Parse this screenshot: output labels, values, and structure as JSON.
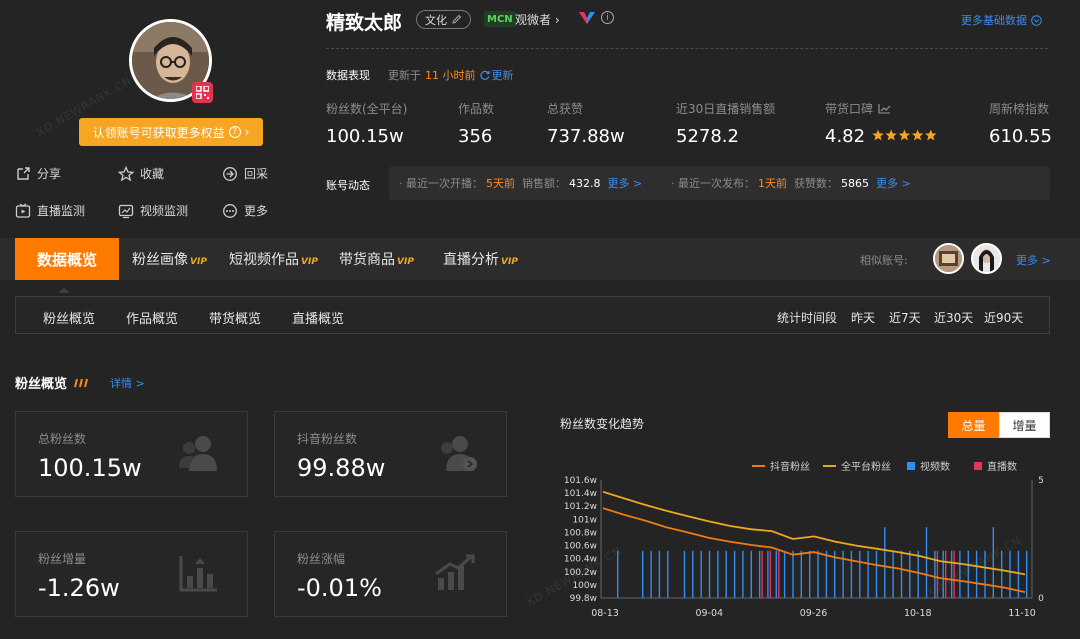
{
  "profile": {
    "claim_text": "认领账号可获取更多权益",
    "actions": [
      {
        "icon": "share-icon",
        "label": "分享"
      },
      {
        "icon": "star-icon",
        "label": "收藏"
      },
      {
        "icon": "back-icon",
        "label": "回采"
      },
      {
        "icon": "live-monitor-icon",
        "label": "直播监测"
      },
      {
        "icon": "video-monitor-icon",
        "label": "视频监测"
      },
      {
        "icon": "more-icon",
        "label": "更多"
      }
    ]
  },
  "header": {
    "name": "精致太郎",
    "tag": "文化",
    "mcn_badge": "MCN",
    "mcn_name": "观微者",
    "more_basic": "更多基础数据",
    "perf_label": "数据表现",
    "updated_prefix": "更新于",
    "updated_time": "11 小时前",
    "refresh": "更新"
  },
  "stats": [
    {
      "label": "粉丝数(全平台)",
      "value": "100.15w"
    },
    {
      "label": "作品数",
      "value": "356"
    },
    {
      "label": "总获赞",
      "value": "737.88w"
    },
    {
      "label": "近30日直播销售额",
      "value": "5278.2"
    },
    {
      "label": "带货口碑",
      "value": "4.82"
    },
    {
      "label": "周新榜指数",
      "value": "610.55"
    }
  ],
  "rating_stars": 4.82,
  "dynamics": {
    "label": "账号动态",
    "live_prefix": "· 最近一次开播：",
    "live_time": "5天前",
    "sales_label": "销售额：",
    "sales_value": "432.8",
    "more1": "更多 >",
    "post_prefix": "· 最近一次发布：",
    "post_time": "1天前",
    "likes_label": "获赞数：",
    "likes_value": "5865",
    "more2": "更多 >"
  },
  "tabs": {
    "active": "数据概览",
    "items": [
      {
        "label": "粉丝画像",
        "vip": "VIP"
      },
      {
        "label": "短视频作品",
        "vip": "VIP"
      },
      {
        "label": "带货商品",
        "vip": "VIP"
      },
      {
        "label": "直播分析",
        "vip": "VIP"
      }
    ],
    "similar_label": "相似账号:",
    "similar_more": "更多 >"
  },
  "subtabs": [
    "粉丝概览",
    "作品概览",
    "带货概览",
    "直播概览"
  ],
  "range": {
    "label": "统计时间段",
    "options": [
      "昨天",
      "近7天",
      "近30天",
      "近90天"
    ],
    "selected": "近90天"
  },
  "section": {
    "title": "粉丝概览",
    "detail": "详情 >"
  },
  "cards": [
    {
      "label": "总粉丝数",
      "value": "100.15w",
      "icon": "users-icon"
    },
    {
      "label": "抖音粉丝数",
      "value": "99.88w",
      "icon": "douyin-users-icon"
    },
    {
      "label": "粉丝增量",
      "value": "-1.26w",
      "icon": "bar-growth-icon"
    },
    {
      "label": "粉丝涨幅",
      "value": "-0.01%",
      "icon": "growth-rate-icon"
    }
  ],
  "chart_panel": {
    "title": "粉丝数变化趋势",
    "toggle": [
      "总量",
      "增量"
    ],
    "toggle_selected": "总量"
  },
  "chart_data": {
    "type": "line",
    "title": "粉丝数变化趋势",
    "x_ticks": [
      "08-13",
      "09-04",
      "09-26",
      "10-18",
      "11-10"
    ],
    "y_ticks": [
      "101.6w",
      "101.4w",
      "101.2w",
      "101w",
      "100.8w",
      "100.6w",
      "100.4w",
      "100.2w",
      "100w",
      "99.8w"
    ],
    "ylim": [
      99.8,
      101.6
    ],
    "y2_ticks": [
      "5",
      "0"
    ],
    "y2lim": [
      0,
      5
    ],
    "legend": [
      "抖音粉丝",
      "全平台粉丝",
      "视频数",
      "直播数"
    ],
    "colors": {
      "douyin": "#f07a12",
      "all": "#f0a81e",
      "video": "#2f8ef0",
      "live": "#e8335a"
    },
    "series": [
      {
        "name": "全平台粉丝",
        "values": [
          101.42,
          101.32,
          101.22,
          101.13,
          101.05,
          100.97,
          100.9,
          100.85,
          100.82,
          100.7,
          100.74,
          100.66,
          100.6,
          100.55,
          100.5,
          100.44,
          100.36,
          100.32,
          100.27,
          100.22,
          100.16
        ]
      },
      {
        "name": "抖音粉丝",
        "values": [
          101.17,
          101.07,
          100.98,
          100.88,
          100.8,
          100.72,
          100.66,
          100.61,
          100.57,
          100.46,
          100.5,
          100.42,
          100.36,
          100.3,
          100.25,
          100.18,
          100.1,
          100.06,
          100.01,
          99.96,
          99.89
        ]
      },
      {
        "name": "视频数",
        "values": [
          2,
          0,
          0,
          2,
          2,
          2,
          2,
          0,
          2,
          2,
          2,
          2,
          2,
          2,
          2,
          2,
          2,
          2,
          2,
          2,
          2,
          2,
          2,
          2,
          2,
          2,
          2,
          2,
          2,
          2,
          2,
          2,
          3,
          2,
          2,
          2,
          2,
          3,
          2,
          2,
          2,
          2,
          2,
          2,
          2,
          3,
          2,
          2,
          2,
          2
        ]
      },
      {
        "name": "直播数",
        "values": [
          0,
          0,
          0,
          0,
          0,
          0,
          0,
          0,
          0,
          0,
          0,
          0,
          0,
          0,
          0,
          0,
          0,
          2,
          2,
          2,
          0,
          0,
          0,
          0,
          0,
          0,
          0,
          0,
          0,
          0,
          0,
          0,
          0,
          0,
          0,
          0,
          0,
          0,
          2,
          2,
          2,
          0,
          0,
          0,
          0,
          0,
          0,
          0,
          0,
          0
        ]
      }
    ]
  }
}
